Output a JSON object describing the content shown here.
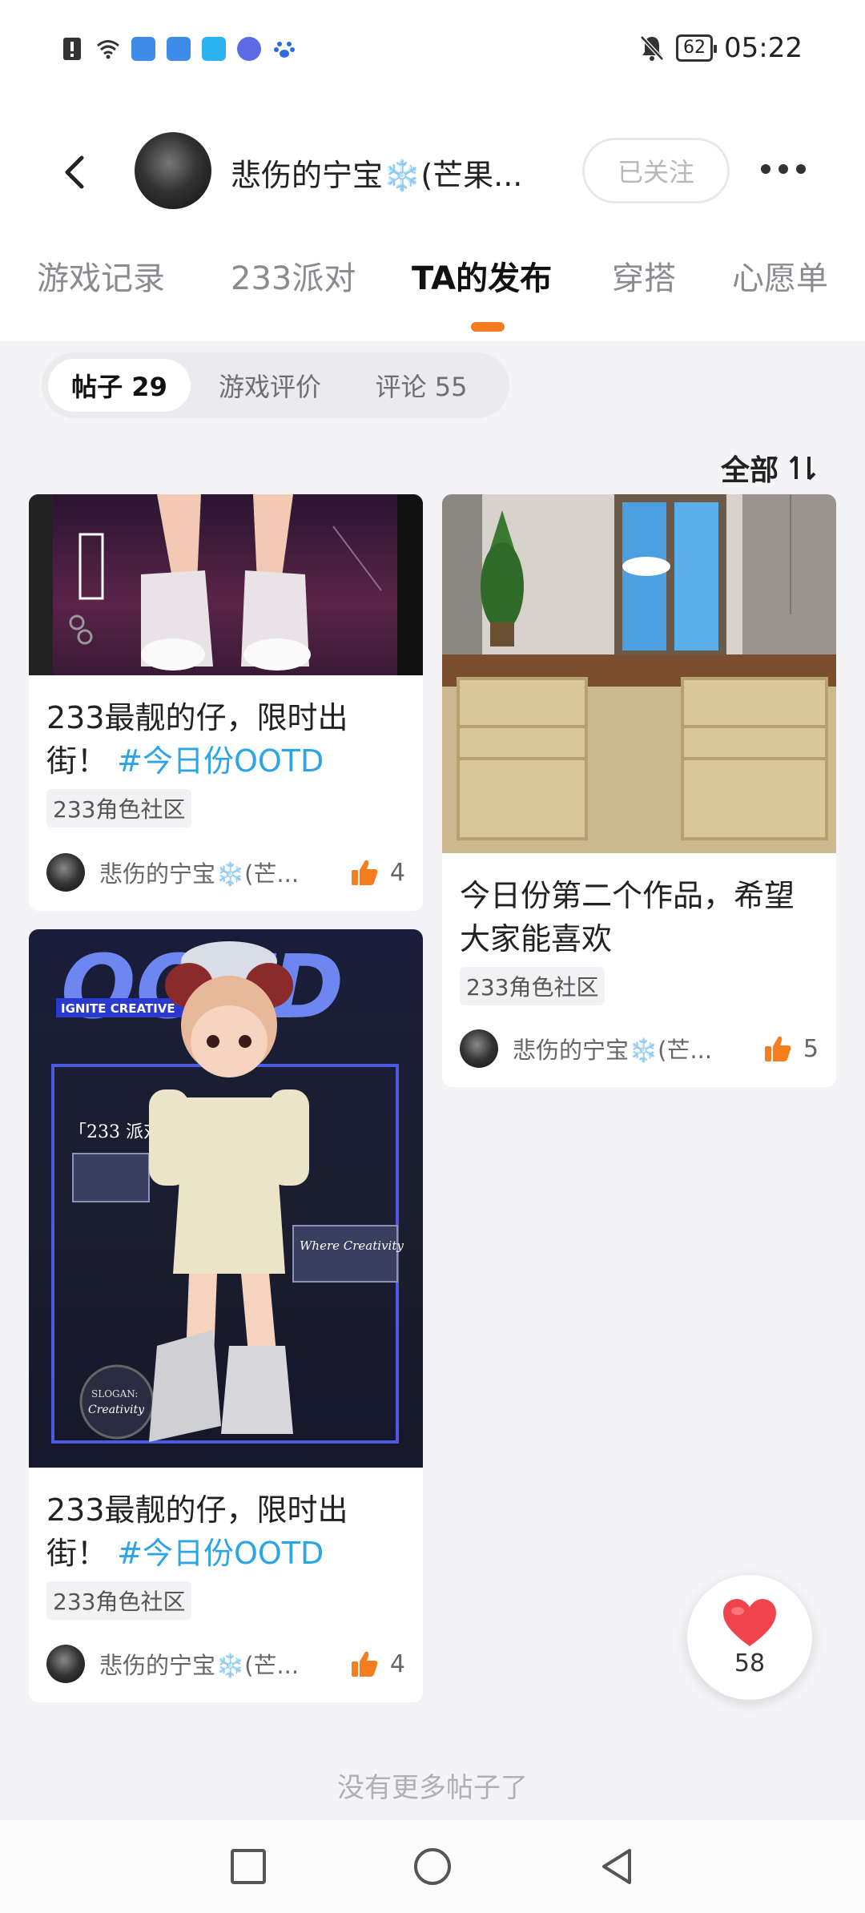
{
  "status_bar": {
    "time": "05:22",
    "battery": "62",
    "icons": [
      "alert-icon",
      "wifi-icon",
      "app-icon",
      "app-icon",
      "weather-icon",
      "music-icon",
      "paw-icon",
      "mute-bell-icon"
    ]
  },
  "header": {
    "title": "悲伤的宁宝❄️(芒果...",
    "follow_label": "已关注"
  },
  "tabs": [
    {
      "label": "游戏记录"
    },
    {
      "label": "233派对"
    },
    {
      "label": "TA的发布"
    },
    {
      "label": "穿搭"
    },
    {
      "label": "心愿单"
    }
  ],
  "subtabs": [
    {
      "label": "帖子 29"
    },
    {
      "label": "游戏评价"
    },
    {
      "label": "评论 55"
    }
  ],
  "sort_label": "全部",
  "posts": [
    {
      "title": "233最靓的仔，限时出街！",
      "hashtag": "#今日份OOTD",
      "tag": "233角色社区",
      "author": "悲伤的宁宝❄️(芒...",
      "likes": "4"
    },
    {
      "title": "今日份第二个作品，希望大家能喜欢",
      "tag": "233角色社区",
      "author": "悲伤的宁宝❄️(芒...",
      "likes": "5"
    },
    {
      "title": "233最靓的仔，限时出街！",
      "hashtag": "#今日份OOTD",
      "tag": "233角色社区",
      "author": "悲伤的宁宝❄️(芒...",
      "likes": "4"
    }
  ],
  "poster_texts": {
    "ootd": "OOTD",
    "ignite": "IGNITE CREATIVE",
    "party": "「233 派对」",
    "where": "Where Creativity",
    "slogan": "SLOGAN:",
    "creativity": "Creativity"
  },
  "heart_count": "58",
  "no_more_text": "没有更多帖子了",
  "colors": {
    "accent": "#f57c1f",
    "hashtag": "#2ba5e6",
    "heart": "#f0444d"
  }
}
